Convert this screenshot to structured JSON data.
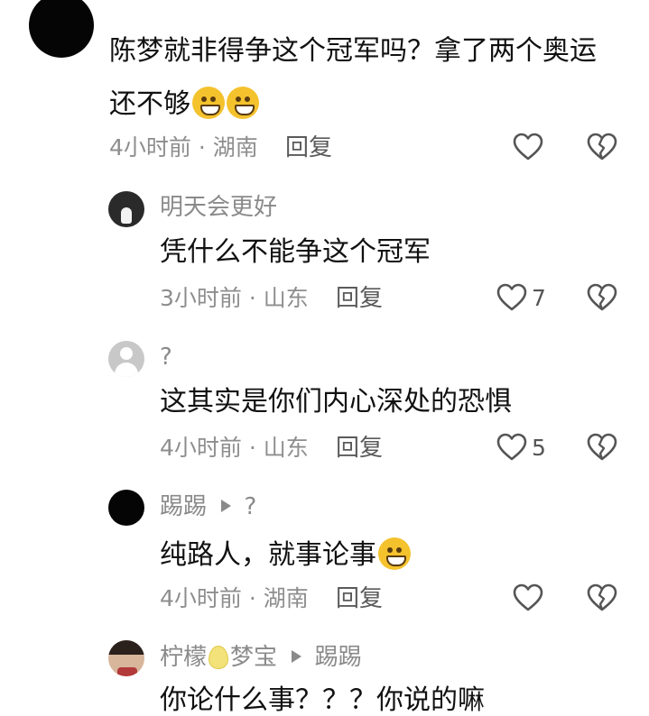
{
  "comments": [
    {
      "name": "",
      "text": "陈梦就非得争这个冠军吗？拿了两个奥运",
      "text2": "还不够",
      "emojis": [
        "grinning-sweat-emoji",
        "grinning-sweat-emoji"
      ],
      "meta": "4小时前 · 湖南",
      "reply": "回复",
      "likes": ""
    },
    {
      "name": "明天会更好",
      "text": "凭什么不能争这个冠军",
      "meta": "3小时前 · 山东",
      "reply": "回复",
      "likes": "7"
    },
    {
      "name": "?",
      "text": "这其实是你们内心深处的恐惧",
      "meta": "4小时前 · 山东",
      "reply": "回复",
      "likes": "5"
    },
    {
      "name": "踢踢",
      "reply_to": "?",
      "text": "纯路人，就事论事",
      "emojis": [
        "smiling-sweat-emoji"
      ],
      "meta": "4小时前 · 湖南",
      "reply": "回复",
      "likes": ""
    },
    {
      "name": "柠檬",
      "name_emoji": "lemon-icon",
      "name_suffix": "梦宝",
      "reply_to": "踢踢",
      "text": "你论什么事？？？你说的嘛"
    }
  ],
  "icons": {
    "like": "heart-outline-icon",
    "dislike": "broken-heart-icon",
    "reply_arrow": "play-triangle-icon"
  },
  "colors": {
    "text": "#111111",
    "secondary": "#8e8e8e",
    "icon": "#555555"
  }
}
